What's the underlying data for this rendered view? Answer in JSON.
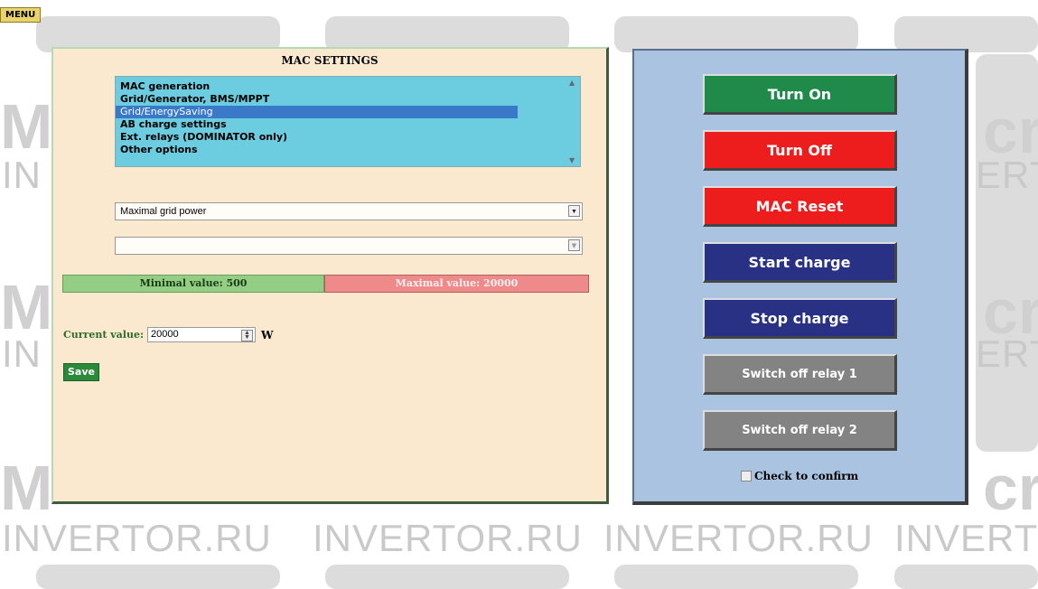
{
  "menu": {
    "label": "MENU"
  },
  "watermark": {
    "text": "INVERTOR.RU",
    "partial_text": "INVERT",
    "fragment_left": "IN",
    "fragment_right": "ERT",
    "letters": "cr",
    "letter_m": "M"
  },
  "mac_settings": {
    "title": "MAC SETTINGS",
    "list_items": [
      {
        "label": "MAC generation",
        "selected": false
      },
      {
        "label": "Grid/Generator, BMS/MPPT",
        "selected": false
      },
      {
        "label": "Grid/EnergySaving",
        "selected": true
      },
      {
        "label": "AB charge settings",
        "selected": false
      },
      {
        "label": "Ext. relays (DOMINATOR only)",
        "selected": false
      },
      {
        "label": "Other options",
        "selected": false
      }
    ],
    "parameter_select": {
      "value": "Maximal grid power"
    },
    "secondary_select": {
      "value": ""
    },
    "min_label": "Minimal value: 500",
    "max_label": "Maximal value: 20000",
    "current_label": "Current value:",
    "current_value": "20000",
    "unit": "W",
    "save_label": "Save"
  },
  "controls": {
    "turn_on": "Turn On",
    "turn_off": "Turn Off",
    "mac_reset": "MAC Reset",
    "start_charge": "Start charge",
    "stop_charge": "Stop charge",
    "relay1": "Switch off relay 1",
    "relay2": "Switch off relay 2",
    "confirm": "Check to confirm"
  },
  "colors": {
    "green_button": "#1f8a4a",
    "red_button": "#ee1d1d",
    "navy_button": "#283184",
    "gray_button": "#838383",
    "left_panel": "#fbe9cf",
    "right_panel": "#a9c3e0",
    "list_bg": "#6dcde0",
    "list_selected": "#3a78c8"
  }
}
